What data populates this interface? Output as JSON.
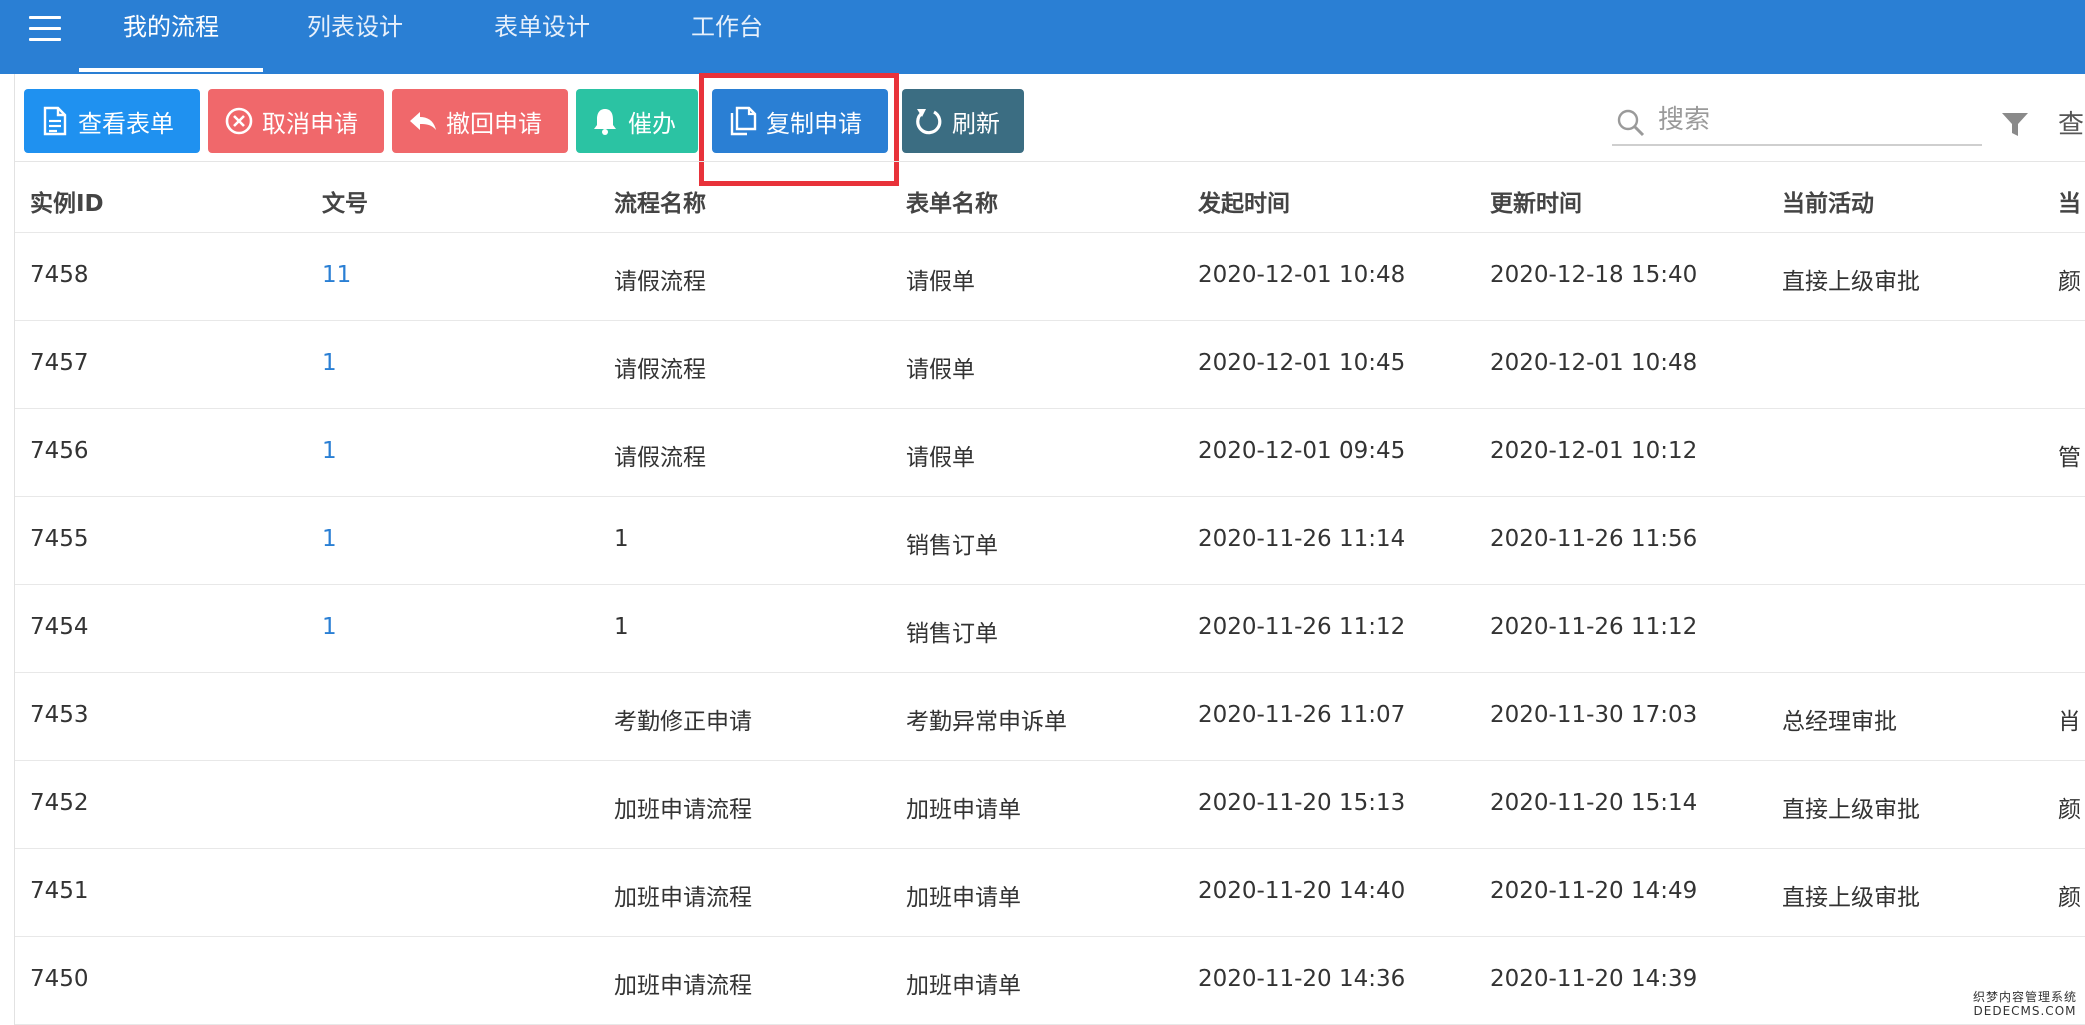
{
  "nav": {
    "tabs": [
      {
        "label": "我的流程",
        "active": true
      },
      {
        "label": "列表设计",
        "active": false
      },
      {
        "label": "表单设计",
        "active": false
      },
      {
        "label": "工作台",
        "active": false
      }
    ]
  },
  "toolbar": {
    "buttons": [
      {
        "label": "查看表单",
        "icon": "document-icon",
        "color": "#1f91f0"
      },
      {
        "label": "取消申请",
        "icon": "cancel-circle-icon",
        "color": "#f0686b"
      },
      {
        "label": "撤回申请",
        "icon": "undo-arrow-icon",
        "color": "#f0686b"
      },
      {
        "label": "催办",
        "icon": "bell-icon",
        "color": "#2bc3a3"
      },
      {
        "label": "复制申请",
        "icon": "copy-icon",
        "color": "#2a7fd4"
      },
      {
        "label": "刷新",
        "icon": "refresh-icon",
        "color": "#3b6d82"
      }
    ],
    "search": {
      "placeholder": "搜索",
      "value": ""
    },
    "truncated_label": "查"
  },
  "table": {
    "columns": [
      "实例ID",
      "文号",
      "流程名称",
      "表单名称",
      "发起时间",
      "更新时间",
      "当前活动",
      "当"
    ],
    "rows": [
      {
        "id": "7458",
        "doc_no": "11",
        "process": "请假流程",
        "form": "请假单",
        "started": "2020-12-01 10:48",
        "updated": "2020-12-18 15:40",
        "activity": "直接上级审批",
        "extra": "颜"
      },
      {
        "id": "7457",
        "doc_no": "1",
        "process": "请假流程",
        "form": "请假单",
        "started": "2020-12-01 10:45",
        "updated": "2020-12-01 10:48",
        "activity": "",
        "extra": ""
      },
      {
        "id": "7456",
        "doc_no": "1",
        "process": "请假流程",
        "form": "请假单",
        "started": "2020-12-01 09:45",
        "updated": "2020-12-01 10:12",
        "activity": "",
        "extra": "管"
      },
      {
        "id": "7455",
        "doc_no": "1",
        "process": "1",
        "form": "销售订单",
        "started": "2020-11-26 11:14",
        "updated": "2020-11-26 11:56",
        "activity": "",
        "extra": ""
      },
      {
        "id": "7454",
        "doc_no": "1",
        "process": "1",
        "form": "销售订单",
        "started": "2020-11-26 11:12",
        "updated": "2020-11-26 11:12",
        "activity": "",
        "extra": ""
      },
      {
        "id": "7453",
        "doc_no": "",
        "process": "考勤修正申请",
        "form": "考勤异常申诉单",
        "started": "2020-11-26 11:07",
        "updated": "2020-11-30 17:03",
        "activity": "总经理审批",
        "extra": "肖"
      },
      {
        "id": "7452",
        "doc_no": "",
        "process": "加班申请流程",
        "form": "加班申请单",
        "started": "2020-11-20 15:13",
        "updated": "2020-11-20 15:14",
        "activity": "直接上级审批",
        "extra": "颜"
      },
      {
        "id": "7451",
        "doc_no": "",
        "process": "加班申请流程",
        "form": "加班申请单",
        "started": "2020-11-20 14:40",
        "updated": "2020-11-20 14:49",
        "activity": "直接上级审批",
        "extra": "颜"
      },
      {
        "id": "7450",
        "doc_no": "",
        "process": "加班申请流程",
        "form": "加班申请单",
        "started": "2020-11-20 14:36",
        "updated": "2020-11-20 14:39",
        "activity": "",
        "extra": ""
      }
    ]
  },
  "watermark": {
    "line1": "织梦内容管理系统",
    "line2": "DEDECMS.COM"
  }
}
